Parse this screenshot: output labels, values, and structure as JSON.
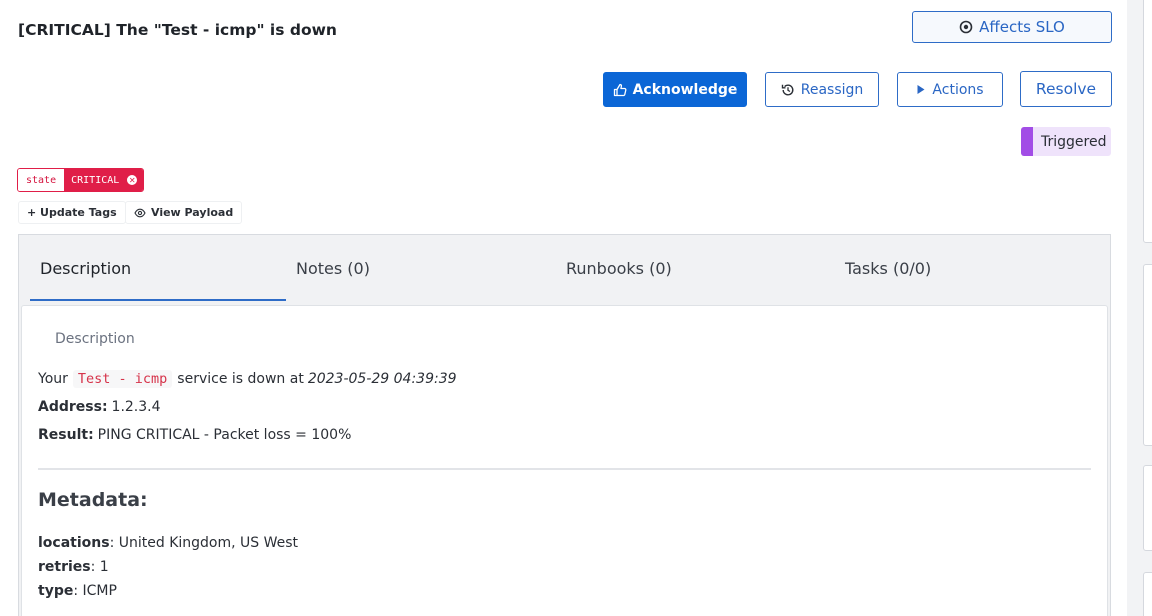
{
  "incident": {
    "title": "[CRITICAL] The \"Test - icmp\" is down",
    "status": "Triggered",
    "status_color": "#a24de6"
  },
  "header_buttons": {
    "affects_slo": "Affects SLO",
    "acknowledge": "Acknowledge",
    "reassign": "Reassign",
    "actions": "Actions",
    "resolve": "Resolve"
  },
  "tags": [
    {
      "key": "state",
      "value": "CRITICAL"
    }
  ],
  "tag_actions": {
    "update_tags": "+ Update Tags",
    "view_payload": "View Payload"
  },
  "tabs": [
    {
      "label": "Description",
      "active": true
    },
    {
      "label": "Notes (0)",
      "active": false
    },
    {
      "label": "Runbooks (0)",
      "active": false
    },
    {
      "label": "Tasks (0/0)",
      "active": false
    }
  ],
  "description": {
    "section_title": "Description",
    "line1_prefix": "Your",
    "service_name": "Test - icmp",
    "line1_middle": "service is down at",
    "timestamp": "2023-05-29 04:39:39",
    "address_label": "Address:",
    "address_value": "1.2.3.4",
    "result_label": "Result:",
    "result_value": "PING CRITICAL - Packet loss = 100%"
  },
  "metadata": {
    "heading": "Metadata:",
    "items": [
      {
        "key": "locations",
        "value": ": United Kingdom, US West"
      },
      {
        "key": "retries",
        "value": ": 1"
      },
      {
        "key": "type",
        "value": ": ICMP"
      }
    ]
  },
  "colors": {
    "primary": "#0b66d6",
    "critical": "#e01e48",
    "triggered": "#a24de6"
  }
}
